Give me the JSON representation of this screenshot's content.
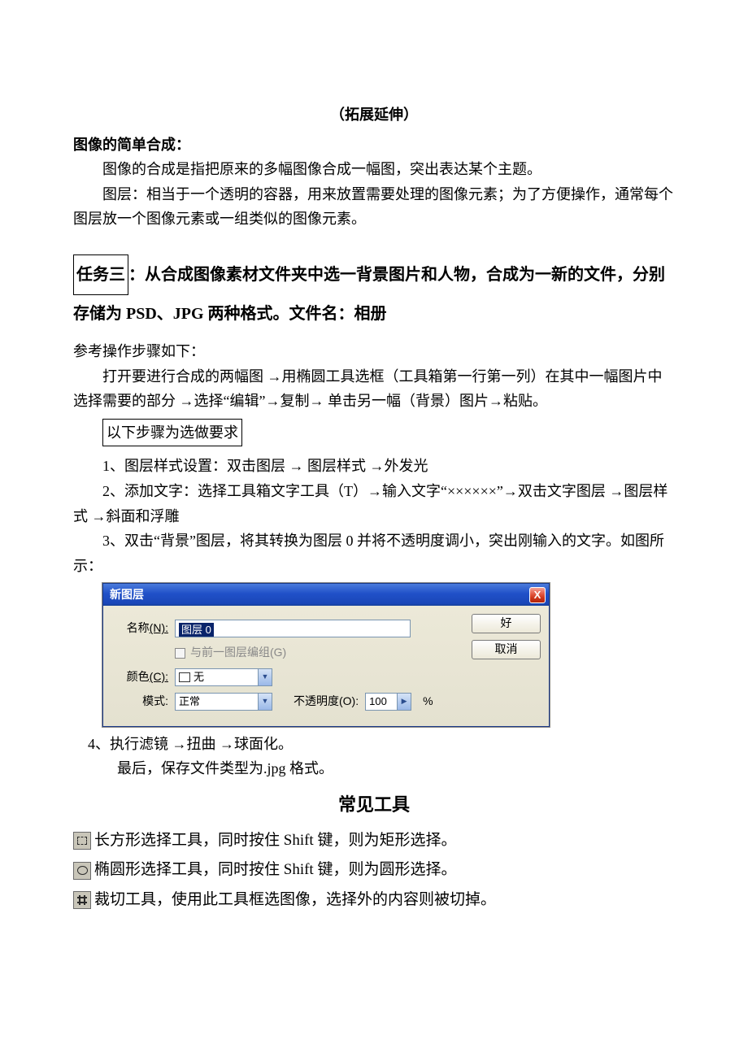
{
  "header": {
    "title_bracket": "（拓展延伸）"
  },
  "section1": {
    "h": "图像的简单合成：",
    "p1": "图像的合成是指把原来的多幅图像合成一幅图，突出表达某个主题。",
    "p2": "图层：相当于一个透明的容器，用来放置需要处理的图像元素；为了方便操作，通常每个图层放一个图像元素或一组类似的图像元素。"
  },
  "task": {
    "label": "任务三",
    "desc": "：从合成图像素材文件夹中选一背景图片和人物，合成为一新的文件，分别存储为 PSD、JPG 两种格式。文件名：相册"
  },
  "refsteps": {
    "intro": "参考操作步骤如下：",
    "p": "打开要进行合成的两幅图 →用椭圆工具选框（工具箱第一行第一列）在其中一幅图片中选择需要的部分  →选择“编辑”→复制→ 单击另一幅（背景）图片→粘贴。",
    "optional_box": "以下步骤为选做要求",
    "s1": "1、图层样式设置：双击图层 → 图层样式 →外发光",
    "s2": "2、添加文字：选择工具箱文字工具（T）→输入文字“××××××”→双击文字图层 →图层样式 →斜面和浮雕",
    "s3": "3、双击“背景”图层，将其转换为图层 0 并将不透明度调小，突出刚输入的文字。如图所示："
  },
  "dialog": {
    "title": "新图层",
    "close": "X",
    "name_label": "名称",
    "name_key": "(N):",
    "name_value": "图层 0",
    "group_label": "与前一图层编组",
    "group_key": "(G)",
    "color_label": "颜色",
    "color_key": "(C):",
    "color_value": "无",
    "mode_label": "模式:",
    "mode_value": "正常",
    "opacity_label": "不透明度",
    "opacity_key": "(O):",
    "opacity_value": "100",
    "opacity_unit": "%",
    "ok": "好",
    "cancel": "取消"
  },
  "after": {
    "s4": "4、执行滤镜  →扭曲  →球面化。",
    "last": "最后，保存文件类型为.jpg 格式。"
  },
  "tools": {
    "h": "常见工具",
    "t1": "长方形选择工具，同时按住 Shift 键，则为矩形选择。",
    "t2": "椭圆形选择工具，同时按住 Shift 键，则为圆形选择。",
    "t3": "裁切工具，使用此工具框选图像，选择外的内容则被切掉。"
  }
}
